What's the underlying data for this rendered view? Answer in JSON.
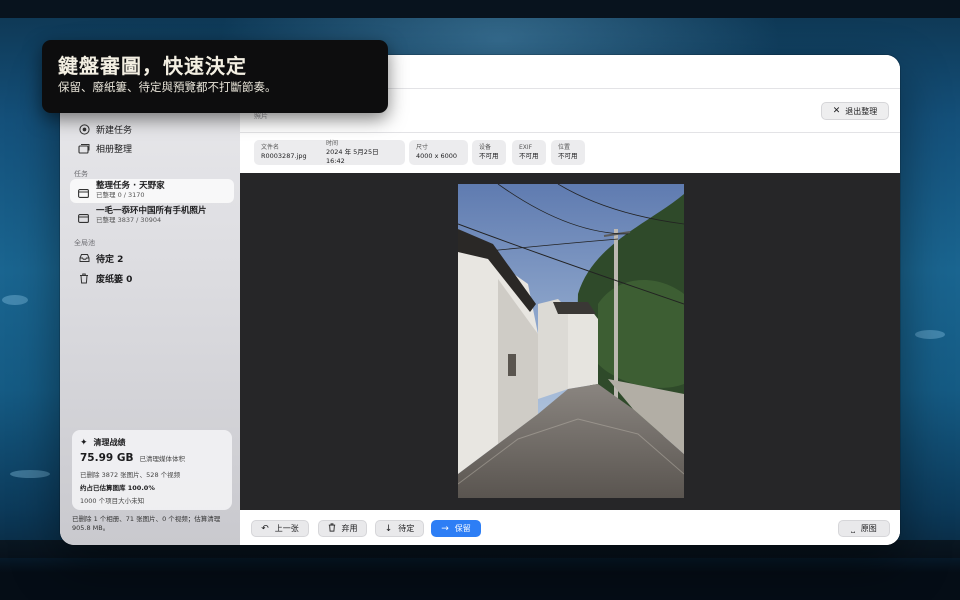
{
  "caption": {
    "headline": "鍵盤審圖，快速決定",
    "subline": "保留、廢紙簍、待定與預覽都不打斷節奏。"
  },
  "sidebar": {
    "actions": [
      {
        "label": "新建任务",
        "icon": "target-icon"
      },
      {
        "label": "相册整理",
        "icon": "photo-stack-icon"
      }
    ],
    "tasks_section": "任务",
    "tasks": [
      {
        "title": "整理任务 · 天野家",
        "progress": "已整理 0 / 3170",
        "selected": true
      },
      {
        "title": "一毛一忝环中国所有手机照片",
        "progress": "已整理 3837 / 30904",
        "selected": false
      }
    ],
    "pool_section": "全局池",
    "pool": [
      {
        "label": "待定 2",
        "icon": "tray-icon"
      },
      {
        "label": "废纸篓 0",
        "icon": "trash-icon"
      }
    ],
    "stats": {
      "title": "清理战绩",
      "size": "75.99 GB",
      "size_note": "已清理媒体体积",
      "deleted": "已删除 3872 张图片、528 个视频",
      "ratio": "约占已估算图库 100.0%",
      "unknown": "1000 个项目大小未知"
    },
    "footer": "已删除 1 个相册、71 张图片、0 个视频；估算清理 905.8 MB。"
  },
  "header": {
    "section_label": "照片",
    "exit_label": "退出整理"
  },
  "meta": [
    {
      "key": "文件名",
      "value": "R0003287.jpg"
    },
    {
      "key": "时间",
      "value": "2024 年 5月25日 16:42"
    },
    {
      "key": "尺寸",
      "value": "4000 x 6000"
    },
    {
      "key": "设备",
      "value": "不可用"
    },
    {
      "key": "EXIF",
      "value": "不可用"
    },
    {
      "key": "位置",
      "value": "不可用"
    }
  ],
  "toolbar": {
    "prev_label": "上一张",
    "discard_label": "弃用",
    "pending_label": "待定",
    "keep_label": "保留",
    "original_label": "原图"
  },
  "colors": {
    "accent": "#2d7ef5",
    "viewer_bg": "#262628"
  }
}
